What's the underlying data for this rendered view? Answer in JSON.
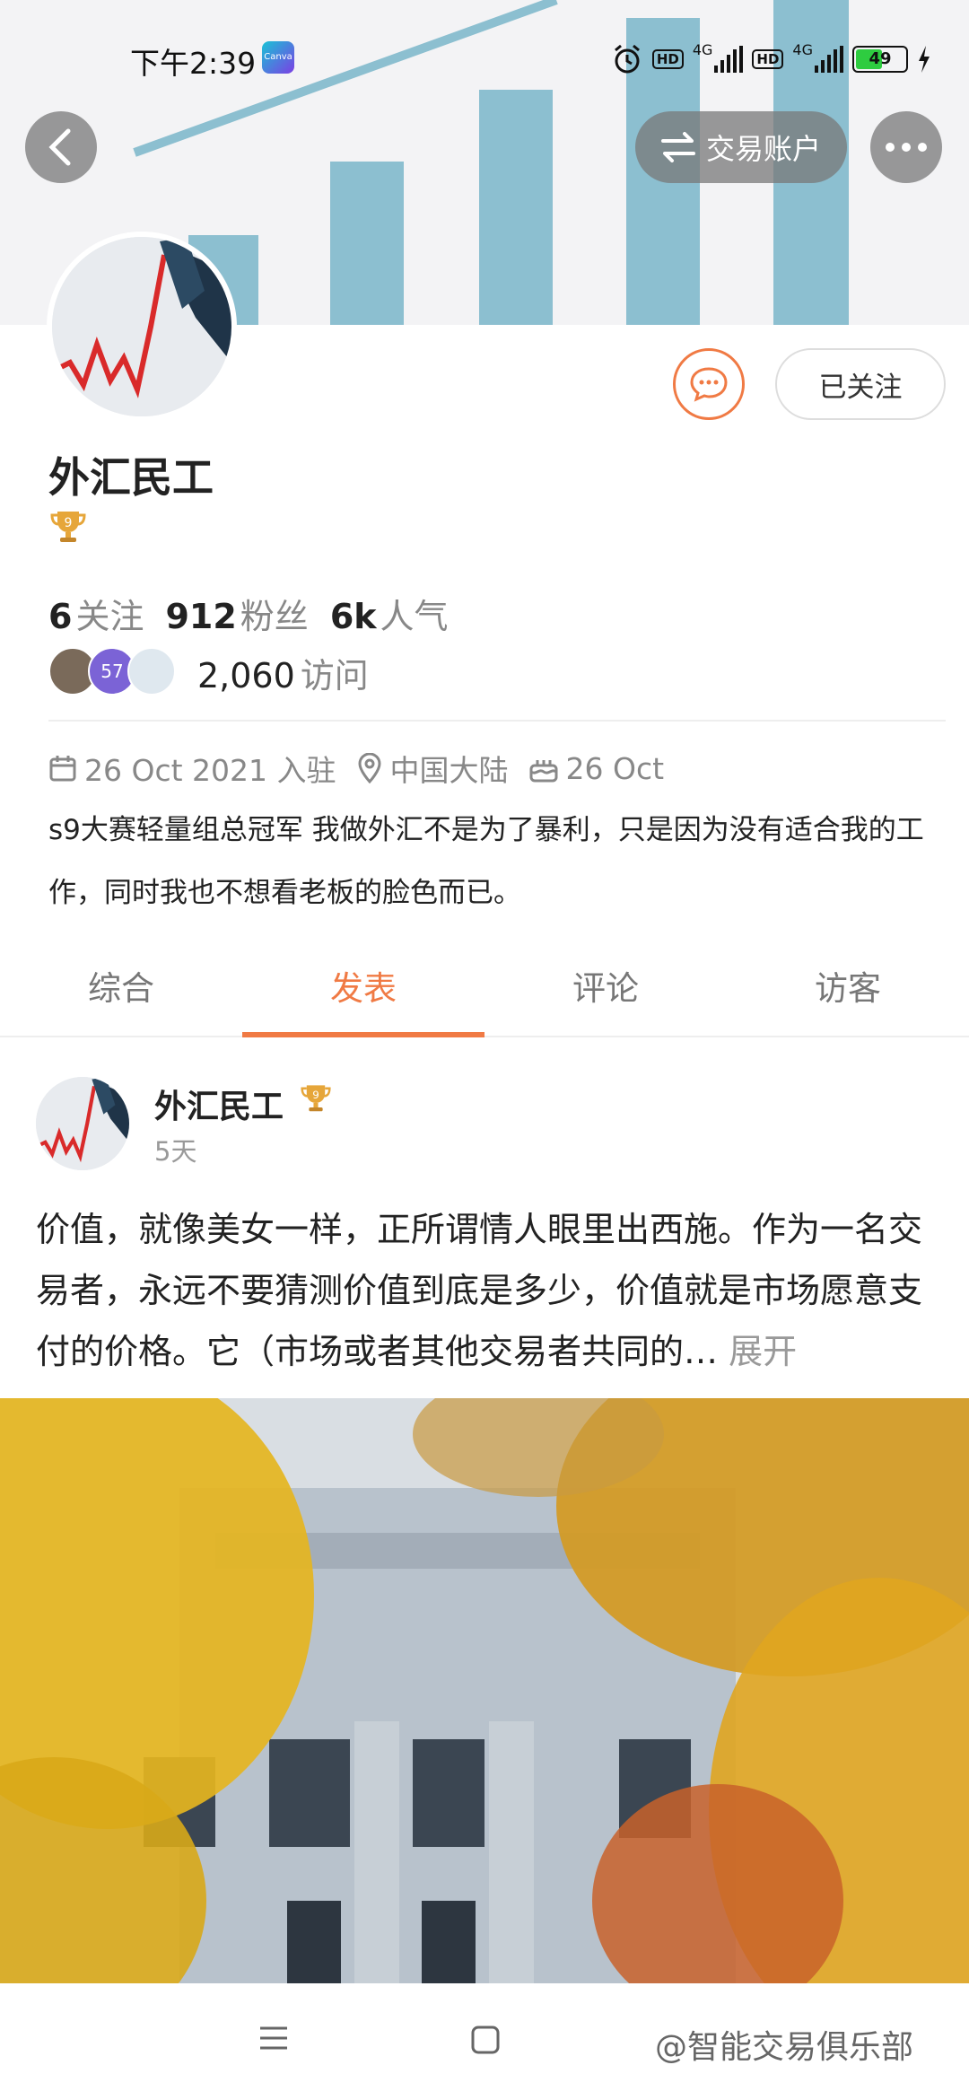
{
  "status_bar": {
    "time": "下午2:39",
    "canva_label": "Canva",
    "hd1": "HD",
    "net1": "4G",
    "hd2": "HD",
    "net2": "4G",
    "battery": "49"
  },
  "header": {
    "back_icon": "chevron-left-icon",
    "trade_account_label": "交易账户",
    "swap_icon": "swap-arrows-icon",
    "more_icon": "more-dots-icon"
  },
  "profile": {
    "name": "外汇民工",
    "level_badge": "9",
    "follow_button_label": "已关注",
    "message_icon": "chat-bubble-icon",
    "stats": [
      {
        "value": "6",
        "label": "关注"
      },
      {
        "value": "912",
        "label": "粉丝"
      },
      {
        "value": "6k",
        "label": "人气"
      }
    ],
    "visitor_avatar_badge": "57",
    "visits_value": "2,060",
    "visits_label": "访问",
    "joined": "26 Oct 2021 入驻",
    "location": "中国大陆",
    "birthday": "26 Oct",
    "bio": "s9大赛轻量组总冠军 我做外汇不是为了暴利，只是因为没有适合我的工作，同时我也不想看老板的脸色而已。"
  },
  "tabs": [
    {
      "label": "综合",
      "active": false
    },
    {
      "label": "发表",
      "active": true
    },
    {
      "label": "评论",
      "active": false
    },
    {
      "label": "访客",
      "active": false
    }
  ],
  "post": {
    "author": "外汇民工",
    "badge": "9",
    "time": "5天",
    "text": "价值，就像美女一样，正所谓情人眼里出西施。作为一名交易者，永远不要猜测价值到底是多少，价值就是市场愿意支付的价格。它（市场或者其他交易者共同的…",
    "expand_label": "展开"
  },
  "watermark": "@智能交易俱乐部",
  "colors": {
    "accent": "#f07a44",
    "banner_bar": "#8cbfd0"
  }
}
